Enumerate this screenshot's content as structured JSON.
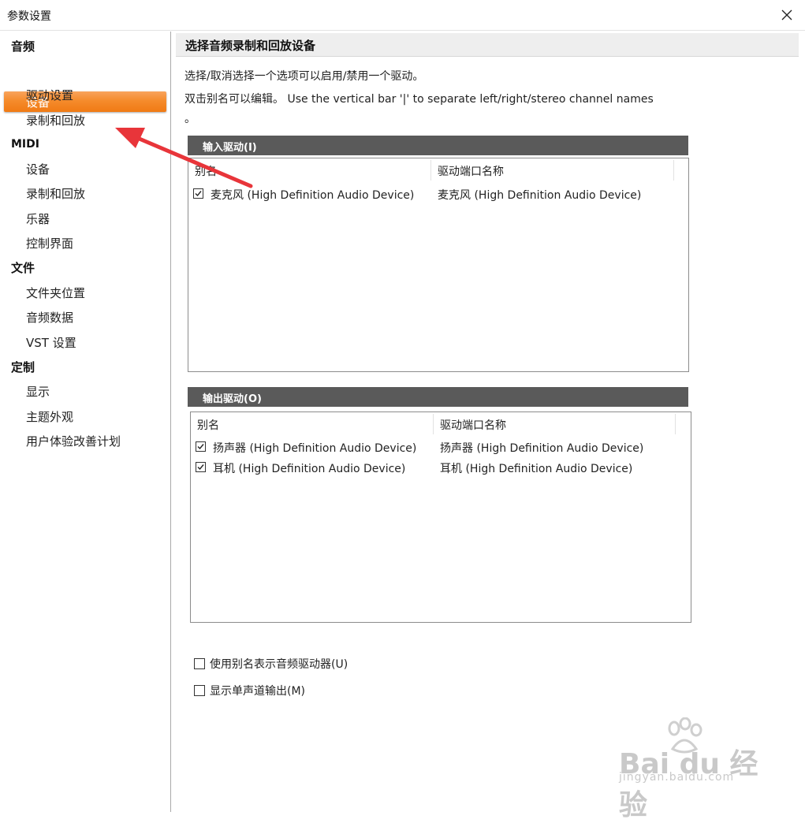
{
  "window": {
    "title": "参数设置"
  },
  "sidebar": {
    "groups": [
      {
        "label": "音频",
        "items": [
          "设备",
          "驱动设置",
          "录制和回放"
        ]
      },
      {
        "label": "MIDI",
        "items": [
          "设备",
          "录制和回放",
          "乐器",
          "控制界面"
        ]
      },
      {
        "label": "文件",
        "items": [
          "文件夹位置",
          "音频数据",
          "VST 设置"
        ]
      },
      {
        "label": "定制",
        "items": [
          "显示",
          "主题外观",
          "用户体验改善计划"
        ]
      }
    ],
    "selected": "音频 / 设备"
  },
  "main": {
    "header": "选择音频录制和回放设备",
    "desc1": "选择/取消选择一个选项可以启用/禁用一个驱动。",
    "desc2": "双击别名可以编辑。 Use the vertical bar '|' to separate left/right/stereo channel names",
    "desc3": "。",
    "input_section": {
      "title": "输入驱动(I)",
      "col_alias": "别名",
      "col_port": "驱动端口名称",
      "rows": [
        {
          "checked": true,
          "alias": "麦克风 (High Definition Audio Device)",
          "port": "麦克风 (High Definition Audio Device)"
        }
      ]
    },
    "output_section": {
      "title": "输出驱动(O)",
      "col_alias": "别名",
      "col_port": "驱动端口名称",
      "rows": [
        {
          "checked": true,
          "alias": "扬声器 (High Definition Audio Device)",
          "port": "扬声器 (High Definition Audio Device)"
        },
        {
          "checked": true,
          "alias": "耳机 (High Definition Audio Device)",
          "port": "耳机 (High Definition Audio Device)"
        }
      ]
    },
    "options": [
      {
        "checked": false,
        "label": "使用别名表示音频驱动器(U)"
      },
      {
        "checked": false,
        "label": "显示单声道输出(M)"
      }
    ]
  },
  "watermark": {
    "brand": "Bai du 经验",
    "url": "jingyan.baidu.com"
  },
  "colors": {
    "selected_gradient_top": "#f8a45c",
    "selected_gradient_bottom": "#f07a14",
    "section_bar": "#5a5a5a",
    "annotation_arrow": "#e8353a"
  }
}
